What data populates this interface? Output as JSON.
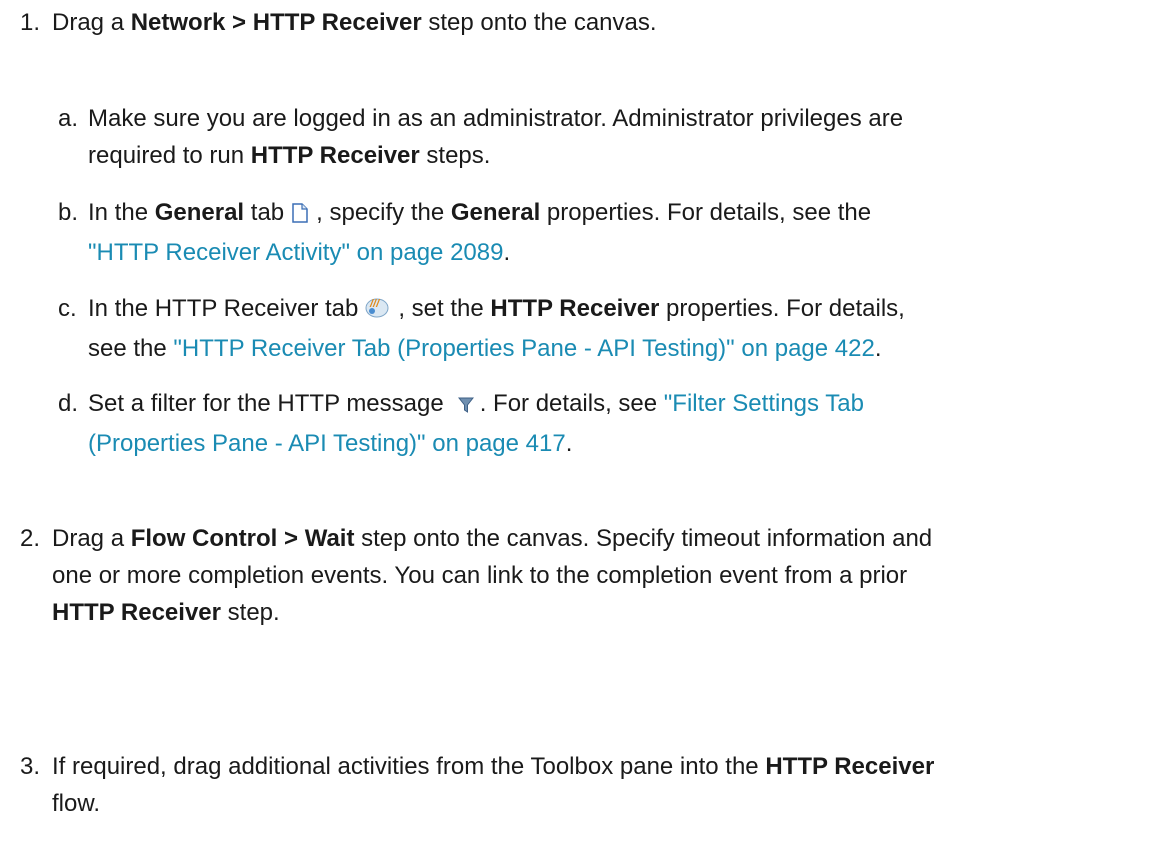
{
  "steps": [
    {
      "num": "1.",
      "pre": "Drag a ",
      "bold": "Network > HTTP Receiver",
      "post": " step onto the canvas.",
      "substeps": [
        {
          "letter": "a.",
          "line1": "Make sure you are logged in as an administrator. Administrator privileges are",
          "line2_bold": "HTTP Receiver",
          "line2_pre": "required to run ",
          "line2_post": " steps."
        },
        {
          "letter": "b.",
          "pre": "In the ",
          "bold1": "General",
          "mid1": " tab",
          "icon": "document-icon",
          "mid2": ", specify the ",
          "bold2": "General",
          "post": " properties. For details, see the",
          "link": "\"HTTP Receiver Activity\" on page 2089",
          "end": "."
        },
        {
          "letter": "c.",
          "pre": "In the HTTP Receiver tab",
          "icon": "http-receiver-icon",
          "mid": ", set the ",
          "bold": "HTTP Receiver",
          "post": " properties. For details,",
          "line2_pre": "see the ",
          "link": "\"HTTP Receiver Tab (Properties Pane - API Testing)\" on page 422",
          "end": "."
        },
        {
          "letter": "d.",
          "pre": "Set a filter for the HTTP message",
          "icon": "filter-icon",
          "mid": ". For details, see ",
          "link_line1": "\"Filter Settings Tab",
          "link_line2": "(Properties Pane - API Testing)\" on page 417",
          "end": "."
        }
      ]
    },
    {
      "num": "2.",
      "pre": "Drag a ",
      "bold": "Flow Control > Wait",
      "line1_post": " step onto the canvas. Specify timeout information and",
      "line2": "one or more completion events. You can link to the completion event from a prior",
      "line3_bold": "HTTP Receiver",
      "line3_post": " step."
    },
    {
      "num": "3.",
      "pre": "If required, drag additional activities from the Toolbox pane into the ",
      "bold": "HTTP Receiver",
      "line2": "flow."
    }
  ]
}
